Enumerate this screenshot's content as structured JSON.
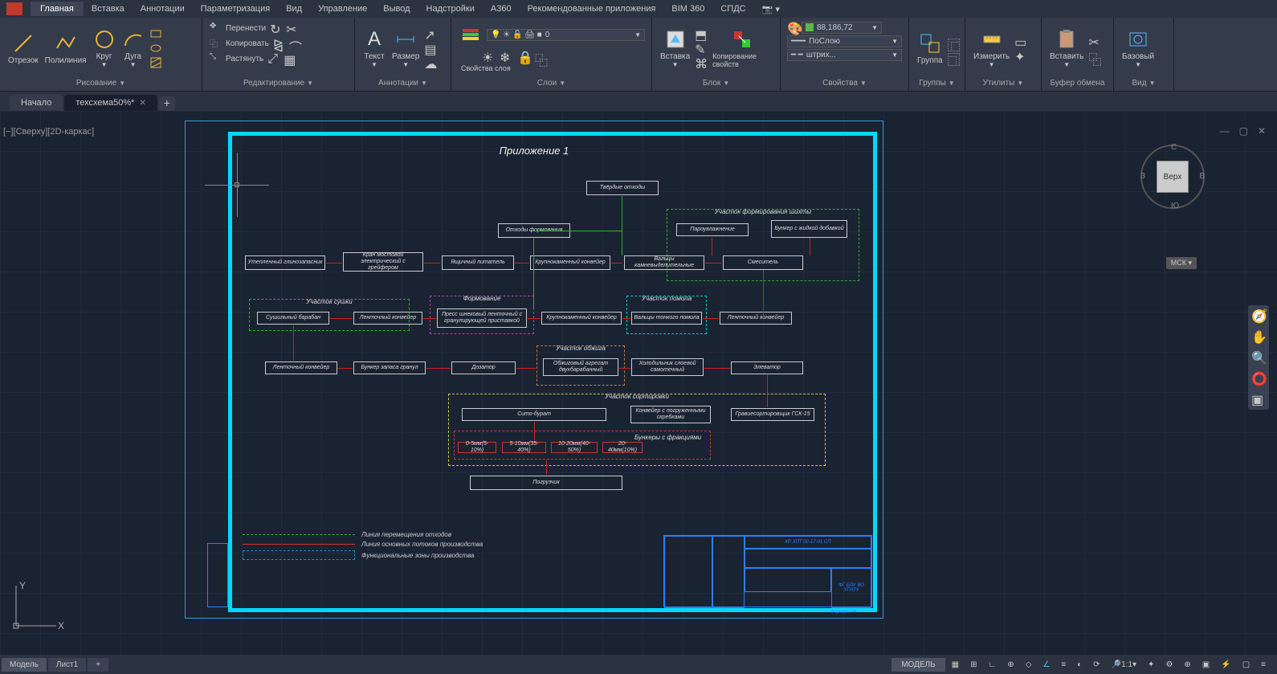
{
  "menubar": {
    "tabs": [
      "Главная",
      "Вставка",
      "Аннотации",
      "Параметризация",
      "Вид",
      "Управление",
      "Вывод",
      "Надстройки",
      "A360",
      "Рекомендованные приложения",
      "BIM 360",
      "СПДС"
    ]
  },
  "ribbon": {
    "draw": {
      "label": "Рисование",
      "line": "Отрезок",
      "pline": "Полилиния",
      "circle": "Круг",
      "arc": "Дуга"
    },
    "edit": {
      "label": "Редактирование",
      "move": "Перенести",
      "copy": "Копировать",
      "stretch": "Растянуть"
    },
    "anno": {
      "label": "Аннотации",
      "text": "Текст",
      "dim": "Размер"
    },
    "layers": {
      "label": "Слои",
      "props": "Свойства слоя",
      "current": "0"
    },
    "block": {
      "label": "Блок",
      "insert": "Вставка",
      "copyprops": "Копирование свойств"
    },
    "props": {
      "label": "Свойства",
      "color": "88,186,72",
      "ltype": "ПоСлою",
      "lweight": "штрих..."
    },
    "groups": {
      "label": "Группы",
      "group": "Группа"
    },
    "utils": {
      "label": "Утилиты",
      "measure": "Измерить"
    },
    "clip": {
      "label": "Буфер обмена",
      "paste": "Вставить"
    },
    "view": {
      "label": "Вид",
      "base": "Базовый"
    }
  },
  "filetabs": {
    "start": "Начало",
    "doc": "техсхема50%*"
  },
  "viewport": {
    "label": "[−][Сверху][2D-каркас]"
  },
  "drawing": {
    "title": "Приложение 1",
    "nodes": {
      "waste": "Твёрдые отходы",
      "formwaste": "Отходы формования",
      "glino": "Утепленный глинозапасник",
      "kran": "Кран мостовой электрический с грейфером",
      "yash": "Ящичный питатель",
      "krupno": "Крупнокаменный конвейер",
      "valts_drob": "Вальцы камневыделительные",
      "smesitel": "Смеситель",
      "zone_shihta": "Участок формирования шихты",
      "paro": "Пароувлажнение",
      "bunker_dob": "Бункер с жидкой добавкой",
      "zone_sushka": "Участок сушки",
      "sush_bar": "Сушильный барабан",
      "lent1": "Ленточный конвейер",
      "zone_form": "Формование",
      "press": "Пресс шнековый ленточный с гранулирующей приставкой",
      "krupno2": "Крупнокаменный конвейер",
      "zone_pomol": "Участок помола",
      "valts_ton": "Вальцы тонкого помола",
      "lent2": "Ленточный конвейер",
      "lent3": "Ленточный конвейер",
      "bunker_gran": "Бункер запаса гранул",
      "dozator": "Дозатор",
      "zone_obzhig": "Участок обжига",
      "obzhig": "Обжиговый агрегат двухбарабанный",
      "holod": "Холодильник слоевой самотечный",
      "elevator": "Элеватор",
      "zone_sort": "Участок сортировки",
      "sito": "Сито-бурат",
      "konv_skr": "Конвейер с погруженными скребками",
      "gravi": "Гравиесортировщик ГСК-15",
      "frac_label": "Бункеры с фракциями",
      "f1": "0-5мм(5-10%)",
      "f2": "5-10мм(35-40%)",
      "f3": "10-20мм(40-50%)",
      "f4": "20-40мм(10%)",
      "pogr": "Погрузчик"
    },
    "legend": {
      "l1": "Линия перемещения отходов",
      "l2": "Линия основных потоков производства",
      "l3": "Функциональные зоны производства"
    },
    "titleblock": {
      "code": "КР ХПТ 02-17-01 СП",
      "org": "ФГ БОУ ВО УГНТУ",
      "fmt": "Формат А4"
    }
  },
  "viewcube": {
    "top": "Верх",
    "n": "С",
    "s": "Ю",
    "e": "В",
    "w": "З"
  },
  "wcs": "МСК",
  "status": {
    "model": "Модель",
    "sheet": "Лист1",
    "modelbtn": "МОДЕЛЬ",
    "scale": "1:1"
  }
}
